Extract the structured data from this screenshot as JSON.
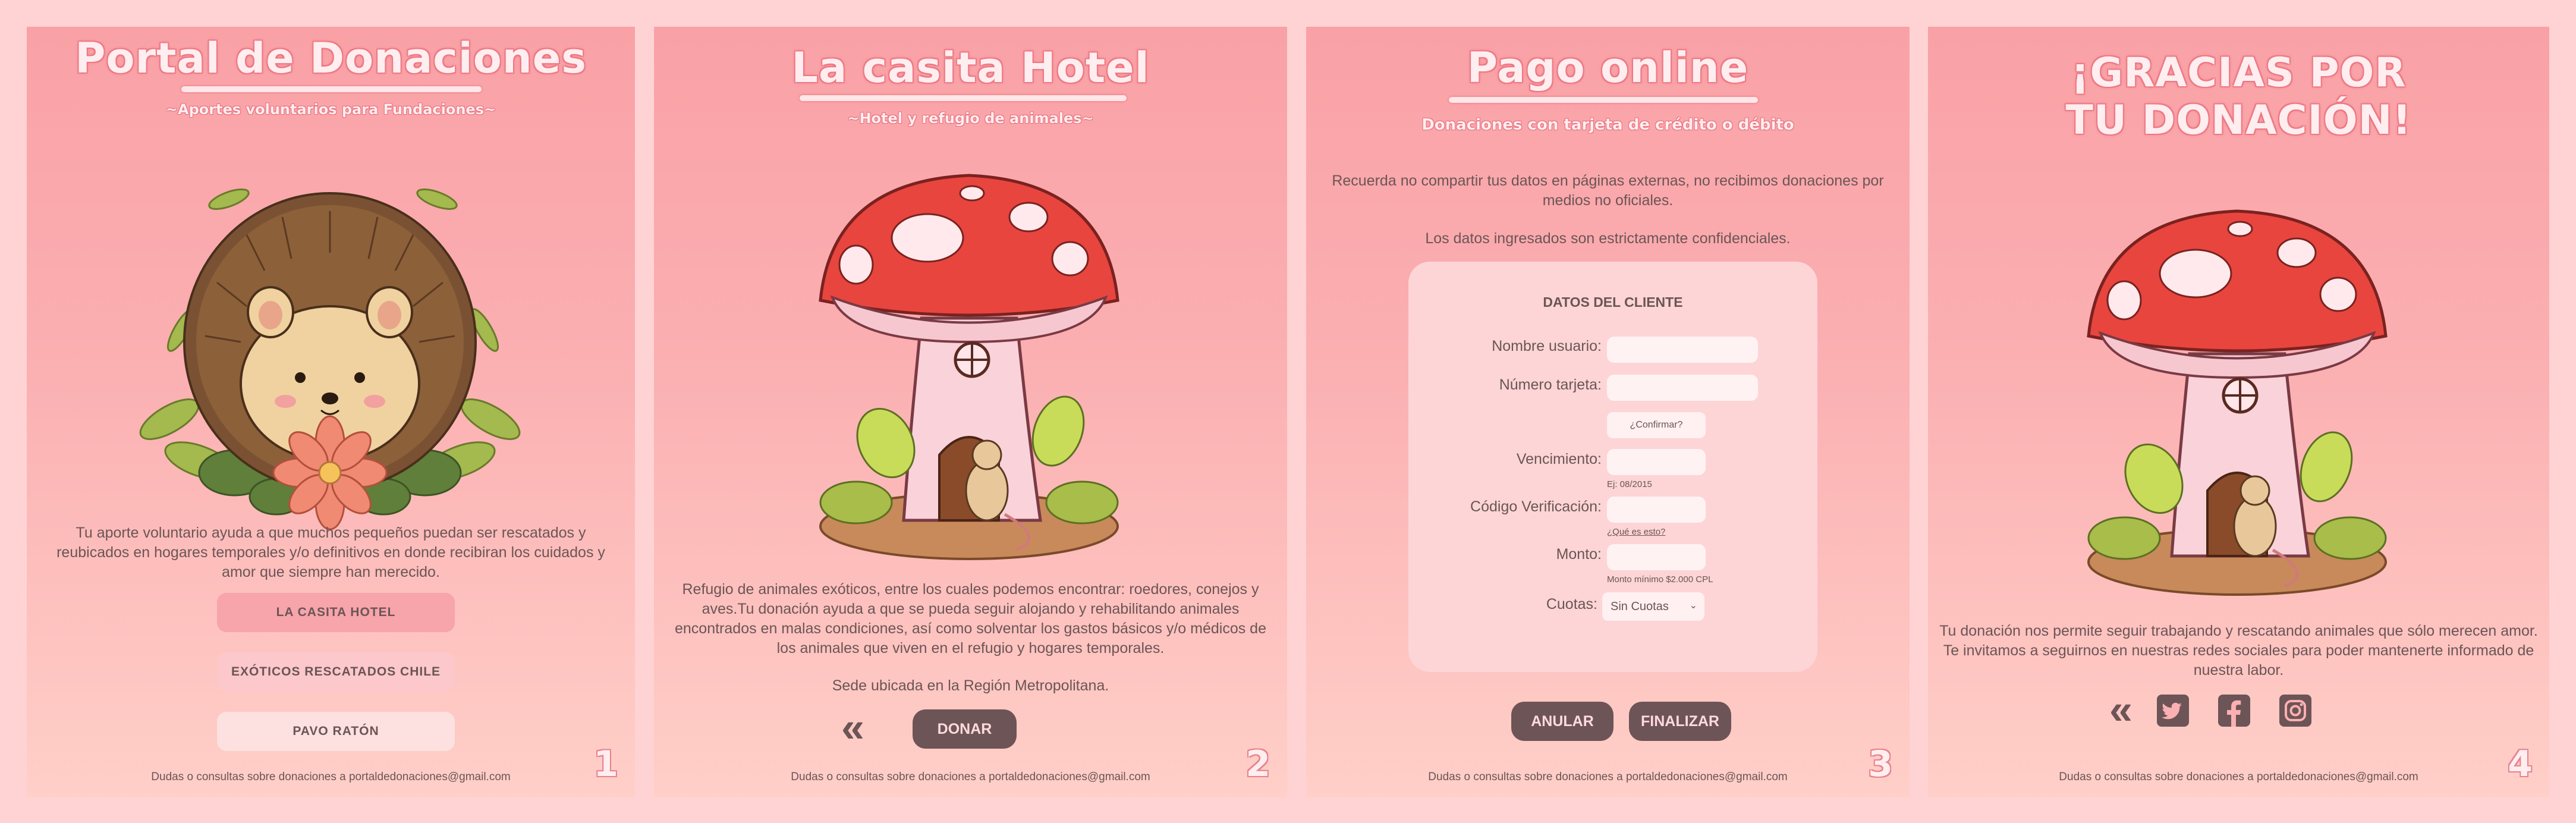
{
  "footer_text": "Dudas o consultas sobre donaciones a portaldedonaciones@gmail.com",
  "panel1": {
    "title": "Portal de Donaciones",
    "subtitle": "~Aportes voluntarios para Fundaciones~",
    "description": "Tu aporte voluntario ayuda a que muchos pequeños puedan ser rescatados y reubicados en hogares temporales y/o definitivos en donde recibiran los cuidados y amor que siempre han merecido.",
    "buttons": [
      "LA CASITA HOTEL",
      "EXÓTICOS RESCATADOS CHILE",
      "PAVO RATÓN"
    ],
    "number": "1"
  },
  "panel2": {
    "title": "La casita Hotel",
    "subtitle": "~Hotel y refugio de animales~",
    "description": "Refugio de animales exóticos, entre los cuales podemos encontrar: roedores, conejos y aves.Tu donación ayuda a que se pueda seguir alojando y rehabilitando animales encontrados en malas condiciones, así como solventar los gastos básicos y/o médicos de los animales que viven en el refugio y hogares temporales.",
    "location": "Sede ubicada en la Región Metropolitana.",
    "back_glyph": "«",
    "donate_label": "DONAR",
    "number": "2"
  },
  "panel3": {
    "title": "Pago online",
    "subtitle": "Donaciones con tarjeta de crédito o débito",
    "warning": "Recuerda no compartir tus datos en páginas externas, no recibimos donaciones por medios no oficiales.",
    "confidential": "Los datos ingresados son estrictamente confidenciales.",
    "form": {
      "heading": "DATOS DEL CLIENTE",
      "user_label": "Nombre usuario:",
      "card_label": "Número tarjeta:",
      "confirm_label": "¿Confirmar?",
      "expiry_label": "Vencimiento:",
      "expiry_hint": "Ej: 08/2015",
      "cvv_label": "Código Verificación:",
      "cvv_hint": "¿Qué es esto?",
      "amount_label": "Monto:",
      "amount_hint": "Monto mínimo $2.000 CPL",
      "installments_label": "Cuotas:",
      "installments_value": "Sin Cuotas"
    },
    "cancel_label": "ANULAR",
    "finish_label": "FINALIZAR",
    "number": "3"
  },
  "panel4": {
    "title_line1": "¡GRACIAS POR",
    "title_line2": "TU DONACIÓN!",
    "description": "Tu donación nos permite seguir trabajando y rescatando animales que sólo merecen amor. Te invitamos a seguirnos en nuestras redes sociales para poder mantenerte informado de nuestra labor.",
    "back_glyph": "«",
    "social_icons": [
      "twitter-icon",
      "facebook-icon",
      "instagram-icon"
    ],
    "number": "4"
  },
  "colors": {
    "panel_top": "#f9a1a6",
    "panel_bottom": "#ffcfc8",
    "text": "#6b5556",
    "dark_button": "#6d5456",
    "title_glow": "#e86d7a"
  }
}
